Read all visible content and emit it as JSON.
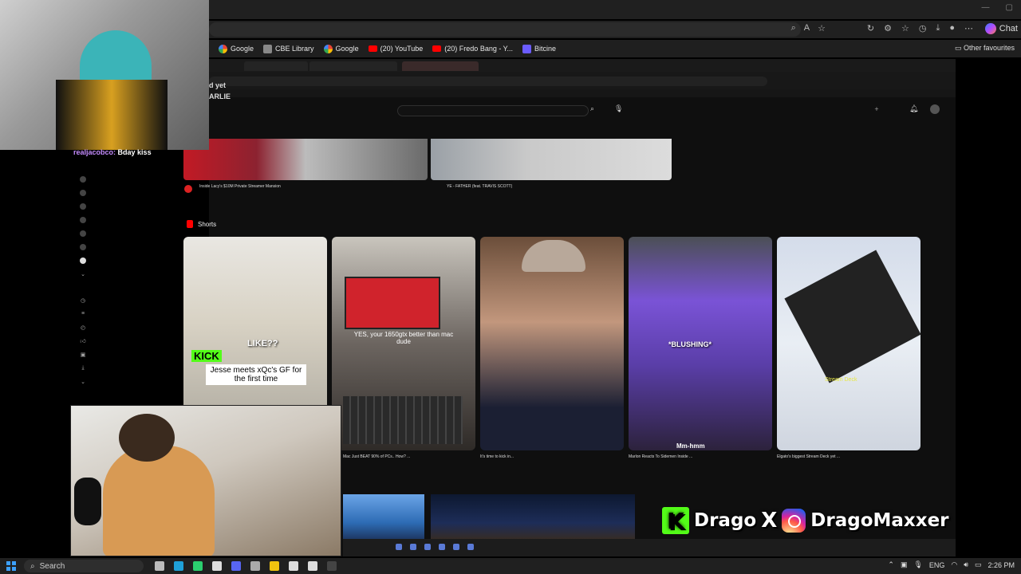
{
  "outer_browser": {
    "favourites": [
      {
        "label": "Google",
        "icon": "google-icon"
      },
      {
        "label": "CBE Library",
        "icon": "cbe-icon"
      },
      {
        "label": "Google",
        "icon": "google-icon"
      },
      {
        "label": "(20) YouTube",
        "icon": "youtube-icon"
      },
      {
        "label": "(20) Fredo Bang - Y...",
        "icon": "youtube-icon"
      },
      {
        "label": "Bitcine",
        "icon": "bitcine-icon"
      }
    ],
    "other_favourites": "Other favourites",
    "chat_label": "Chat"
  },
  "stream_overlay": {
    "chat_user": "realjacob",
    "chat_suffix": "co:",
    "chat_message": "Bday kiss",
    "watermark": {
      "kick_name": "Drago",
      "separator": "X",
      "instagram_name": "DragoMaxxer"
    }
  },
  "youtube": {
    "partial_header": "d yet",
    "partial_header_2": "ARLIE",
    "shorts_label": "Shorts",
    "videos_top": [
      {
        "title": "Inside Lacy's $10M Private Streamer Mansion"
      },
      {
        "title": "YE - FATHER (feat. TRAVIS SCOTT)"
      }
    ],
    "shorts": [
      {
        "title": "",
        "overlay_top": "LIKE??",
        "overlay_text": "Jesse meets xQc's GF for the first time",
        "kick_badge": "KICK"
      },
      {
        "title": "Mac Just BEAT 90% of PCs.. How? ...",
        "overlay_text": "YES, your 1650gtx better than mac dude"
      },
      {
        "title": "It's time to kick in...",
        "overlay_text": ""
      },
      {
        "title": "Marlon Reacts To Sidemen Inside ...",
        "overlay_text": "*BLUSHING*",
        "bottom_text": "Mm-hmm"
      },
      {
        "title": "Elgato's biggest Stream Deck yet ...",
        "overlay_text": "Stream Deck"
      }
    ]
  },
  "taskbar": {
    "search_placeholder": "Search",
    "language": "ENG",
    "time": "2:26 PM"
  }
}
